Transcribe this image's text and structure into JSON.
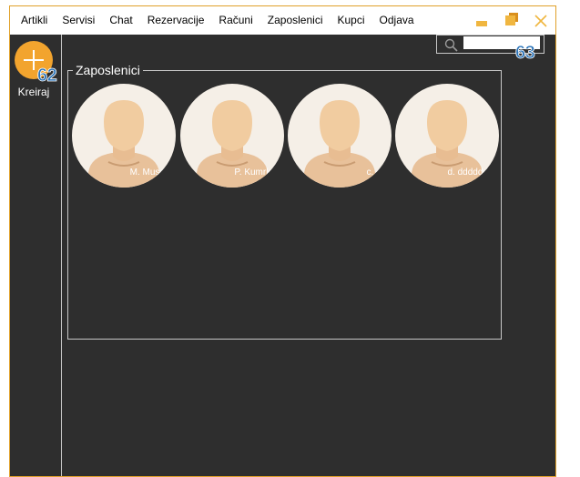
{
  "menu": {
    "items": [
      "Artikli",
      "Servisi",
      "Chat",
      "Rezervacije",
      "Računi",
      "Zaposlenici",
      "Kupci",
      "Odjava"
    ]
  },
  "window_controls": {
    "icons": [
      "minimize-icon",
      "restore-icon",
      "close-icon"
    ],
    "accent": "#f0b640"
  },
  "sidebar": {
    "add_label": "Kreiraj",
    "add_badge": "62",
    "add_color": "#f2a42e"
  },
  "search": {
    "value": "",
    "badge": "63"
  },
  "employees": {
    "title": "Zaposlenici",
    "items": [
      {
        "name": "M. Musa"
      },
      {
        "name": "P. Kumrle"
      },
      {
        "name": "c. c"
      },
      {
        "name": "d. dddddd"
      }
    ]
  },
  "colors": {
    "background": "#2e2e2e",
    "border_accent": "#e0a12a",
    "badge": "#2a73b8"
  }
}
